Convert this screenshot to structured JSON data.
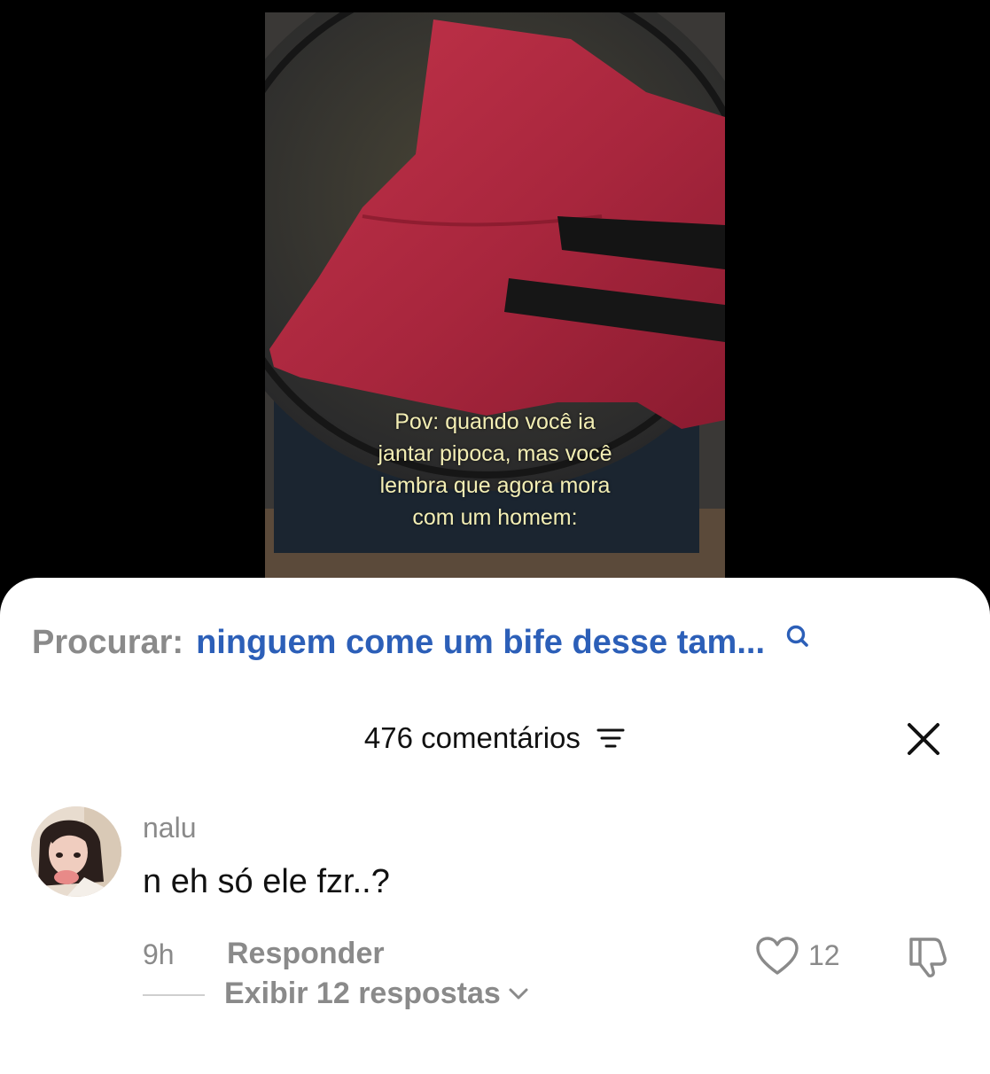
{
  "video": {
    "caption_lines": [
      "Pov: quando você ia",
      "jantar pipoca, mas você",
      "lembra que agora mora",
      "com um homem:"
    ]
  },
  "search": {
    "label": "Procurar:",
    "query": "ninguem come um bife desse tam..."
  },
  "comments_header": {
    "count_label": "476 comentários"
  },
  "comment": {
    "username": "nalu",
    "text": "n eh só ele fzr..?",
    "time": "9h",
    "reply_label": "Responder",
    "like_count": "12",
    "view_replies_label": "Exibir 12 respostas"
  },
  "colors": {
    "search_query": "#2c5fb8",
    "muted_text": "#8a8a8a",
    "caption": "#f3eeb4"
  },
  "icons": [
    "search-icon",
    "filter-icon",
    "close-icon",
    "heart-icon",
    "dislike-icon",
    "chevron-down-icon"
  ]
}
